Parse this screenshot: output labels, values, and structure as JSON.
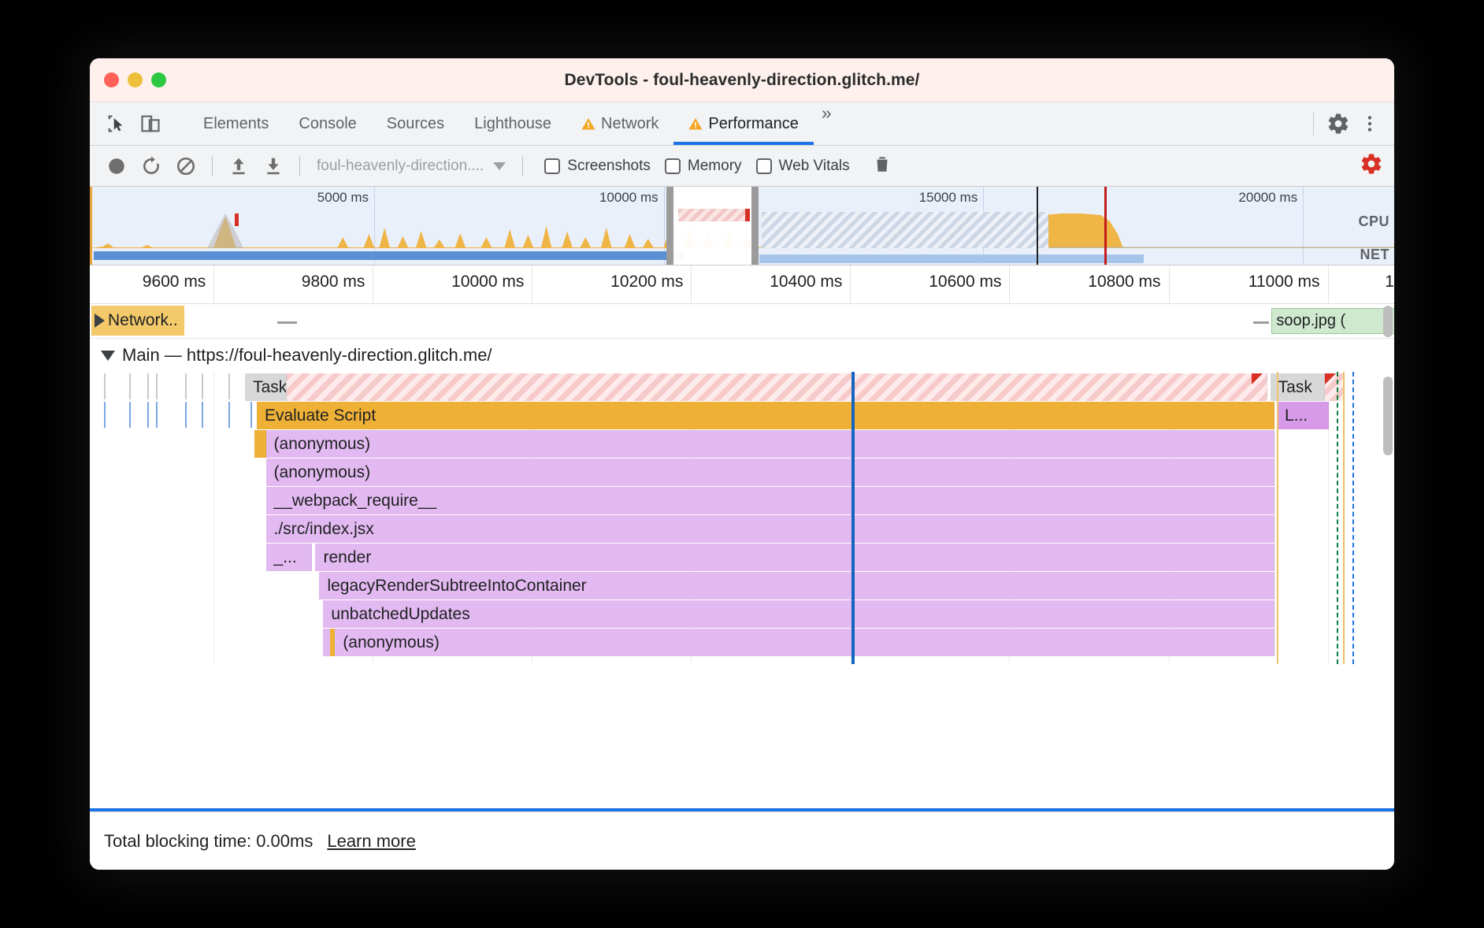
{
  "window": {
    "title": "DevTools - foul-heavenly-direction.glitch.me/",
    "traffic_lights": [
      "close",
      "minimize",
      "maximize"
    ]
  },
  "tabbar": {
    "left_icons": [
      {
        "name": "inspect-element-icon"
      },
      {
        "name": "device-toolbar-icon"
      }
    ],
    "tabs": [
      {
        "label": "Elements",
        "warn": false,
        "active": false
      },
      {
        "label": "Console",
        "warn": false,
        "active": false
      },
      {
        "label": "Sources",
        "warn": false,
        "active": false
      },
      {
        "label": "Lighthouse",
        "warn": false,
        "active": false
      },
      {
        "label": "Network",
        "warn": true,
        "active": false
      },
      {
        "label": "Performance",
        "warn": true,
        "active": true
      }
    ],
    "overflow_label": "»",
    "right_icons": [
      {
        "name": "settings-gear-icon"
      },
      {
        "name": "more-vertical-icon"
      }
    ]
  },
  "perf_toolbar": {
    "record_label": "record",
    "reload_label": "reload-and-record",
    "clear_label": "clear",
    "upload_label": "load-profile",
    "download_label": "save-profile",
    "url_select_value": "foul-heavenly-direction....",
    "checkboxes": [
      {
        "label": "Screenshots",
        "checked": false
      },
      {
        "label": "Memory",
        "checked": false
      },
      {
        "label": "Web Vitals",
        "checked": false
      }
    ],
    "trash_label": "collect-garbage",
    "settings_label": "capture-settings"
  },
  "overview": {
    "ticks": [
      {
        "label": "5000 ms",
        "x_pct": 21.8
      },
      {
        "label": "10000 ms",
        "x_pct": 44.0
      },
      {
        "label": "15000 ms",
        "x_pct": 68.5
      },
      {
        "label": "20000 ms",
        "x_pct": 93.0
      }
    ],
    "lane_labels": [
      "CPU",
      "NET"
    ],
    "selection": {
      "start_pct": 44.6,
      "end_pct": 51.0
    }
  },
  "detail_ruler": {
    "ticks": [
      {
        "label": "9600 ms",
        "x_pct": 9.5
      },
      {
        "label": "9800 ms",
        "x_pct": 21.7
      },
      {
        "label": "10000 ms",
        "x_pct": 33.9
      },
      {
        "label": "10200 ms",
        "x_pct": 46.1
      },
      {
        "label": "10400 ms",
        "x_pct": 58.3
      },
      {
        "label": "10600 ms",
        "x_pct": 70.5
      },
      {
        "label": "10800 ms",
        "x_pct": 82.7
      },
      {
        "label": "11000 ms",
        "x_pct": 94.9
      },
      {
        "label": "1",
        "x_pct": 100.0
      }
    ]
  },
  "network_track": {
    "group_label": "Network..",
    "items": [
      {
        "label": "soop.jpg (",
        "x_pct": 90.6,
        "width_pct": 9.4
      }
    ]
  },
  "flame_chart": {
    "header": "Main — https://foul-heavenly-direction.glitch.me/",
    "rows": [
      {
        "depth": 0,
        "bars": [
          {
            "label": "Task",
            "kind": "task",
            "x_pct": 11.9,
            "width_pct": 78.4
          },
          {
            "label": "Task",
            "kind": "task",
            "x_pct": 90.5,
            "width_pct": 5.6
          }
        ]
      },
      {
        "depth": 1,
        "bars": [
          {
            "label": "Evaluate Script",
            "kind": "eval",
            "x_pct": 12.8,
            "width_pct": 78.0
          },
          {
            "label": "L...",
            "kind": "purple2",
            "x_pct": 91.0,
            "width_pct": 4.0
          }
        ]
      },
      {
        "depth": 2,
        "bars": [
          {
            "label": "(anonymous)",
            "kind": "purple",
            "x_pct": 12.8,
            "width_pct": 78.0
          }
        ]
      },
      {
        "depth": 3,
        "bars": [
          {
            "label": "(anonymous)",
            "kind": "purple",
            "x_pct": 13.4,
            "width_pct": 77.4
          }
        ]
      },
      {
        "depth": 4,
        "bars": [
          {
            "label": "__webpack_require__",
            "kind": "purple",
            "x_pct": 13.4,
            "width_pct": 77.4
          }
        ]
      },
      {
        "depth": 5,
        "bars": [
          {
            "label": "./src/index.jsx",
            "kind": "purple",
            "x_pct": 13.4,
            "width_pct": 77.4
          }
        ]
      },
      {
        "depth": 6,
        "bars": [
          {
            "label": "_...",
            "kind": "purple",
            "x_pct": 13.4,
            "width_pct": 3.8
          },
          {
            "label": "render",
            "kind": "purple",
            "x_pct": 17.5,
            "width_pct": 73.3
          }
        ]
      },
      {
        "depth": 7,
        "bars": [
          {
            "label": "legacyRenderSubtreeIntoContainer",
            "kind": "purple",
            "x_pct": 17.8,
            "width_pct": 73.0
          }
        ]
      },
      {
        "depth": 8,
        "bars": [
          {
            "label": "unbatchedUpdates",
            "kind": "purple",
            "x_pct": 18.1,
            "width_pct": 72.7
          }
        ]
      },
      {
        "depth": 9,
        "bars": [
          {
            "label": "(anonymous)",
            "kind": "purple",
            "x_pct": 18.1,
            "width_pct": 72.7
          }
        ]
      }
    ]
  },
  "statusbar": {
    "text": "Total blocking time: 0.00ms",
    "link": "Learn more"
  },
  "colors": {
    "accent": "#1a73e8",
    "warning": "#f5a623",
    "record_red": "#d93025",
    "eval_script": "#efb036",
    "js_function": "#e2b9f0",
    "task_gray": "#d8d8d8",
    "network_group": "#f4c96a",
    "net_blue": "#5b8fd6"
  }
}
